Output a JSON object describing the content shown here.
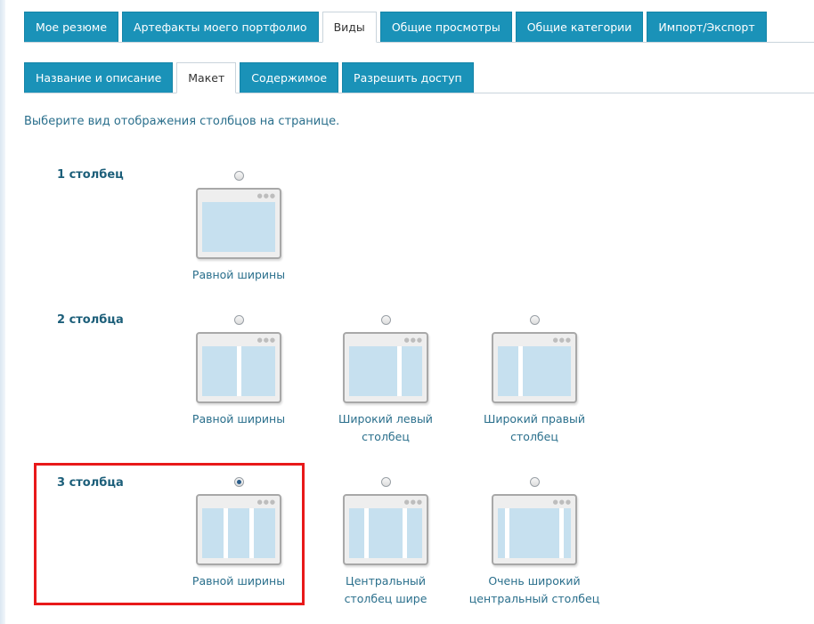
{
  "main_tabs": [
    {
      "label": "Мое резюме",
      "active": false
    },
    {
      "label": "Артефакты моего портфолио",
      "active": false
    },
    {
      "label": "Виды",
      "active": true
    },
    {
      "label": "Общие просмотры",
      "active": false
    },
    {
      "label": "Общие категории",
      "active": false
    },
    {
      "label": "Импорт/Экспорт",
      "active": false
    }
  ],
  "sub_tabs": [
    {
      "label": "Название и описание",
      "active": false
    },
    {
      "label": "Макет",
      "active": true
    },
    {
      "label": "Содержимое",
      "active": false
    },
    {
      "label": "Разрешить доступ",
      "active": false
    }
  ],
  "instructions": "Выберите вид отображения столбцов на странице.",
  "groups": [
    {
      "label": "1 столбец",
      "options": [
        {
          "label": "Равной ширины",
          "checked": false,
          "icon": "layout-1col-icon"
        }
      ]
    },
    {
      "label": "2 столбца",
      "options": [
        {
          "label": "Равной ширины",
          "checked": false,
          "icon": "layout-2col-equal-icon"
        },
        {
          "label": "Широкий левый столбец",
          "checked": false,
          "icon": "layout-2col-wide-left-icon"
        },
        {
          "label": "Широкий правый столбец",
          "checked": false,
          "icon": "layout-2col-wide-right-icon"
        }
      ]
    },
    {
      "label": "3 столбца",
      "options": [
        {
          "label": "Равной ширины",
          "checked": true,
          "icon": "layout-3col-equal-icon"
        },
        {
          "label": "Центральный столбец шире",
          "checked": false,
          "icon": "layout-3col-center-wide-icon"
        },
        {
          "label": "Очень широкий центральный столбец",
          "checked": false,
          "icon": "layout-3col-center-very-wide-icon"
        }
      ]
    }
  ],
  "colors": {
    "tab_bg": "#1a92b8",
    "heading": "#1d5f7a",
    "link_text": "#2a6f8c",
    "highlight": "#e8191a",
    "layout_fill": "#c6e0ef"
  }
}
